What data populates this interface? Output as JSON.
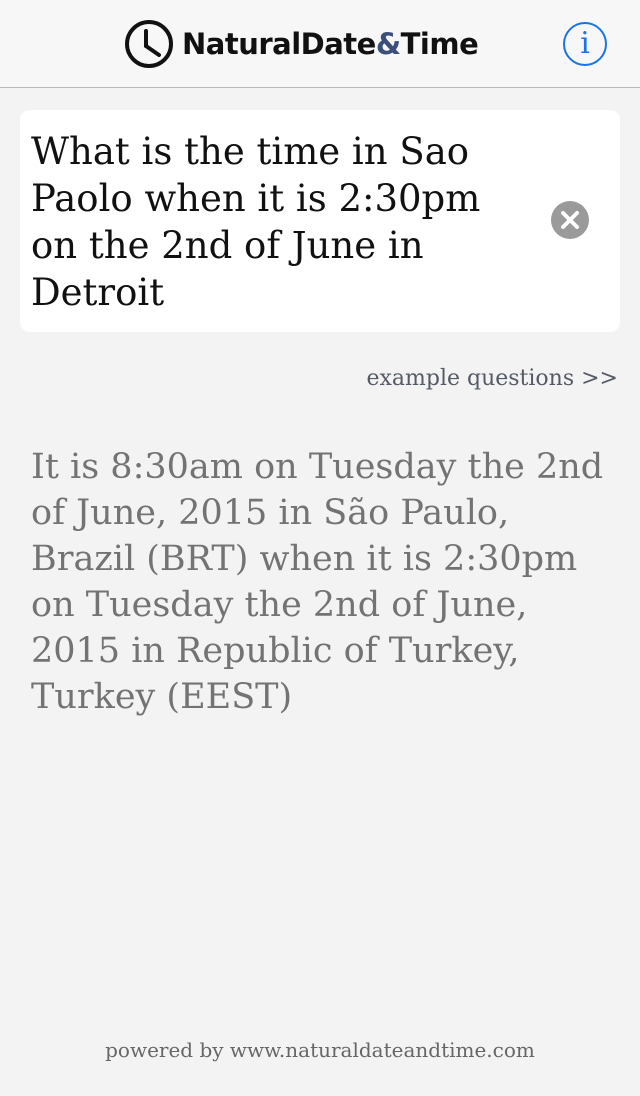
{
  "header": {
    "logo": {
      "part1": "NaturalDate",
      "amp": "&",
      "part2": "Time",
      "icon": "clock-icon"
    },
    "info_button": {
      "label": "i",
      "icon": "info-icon",
      "color": "#1a73e8"
    }
  },
  "question": {
    "value": "What is the time in Sao Paolo when it is 2:30pm on the 2nd of June in Detroit",
    "clear_icon": "clear-icon"
  },
  "example_link": "example questions >>",
  "answer": "It is 8:30am on Tuesday the 2nd of June, 2015 in São Paulo, Brazil (BRT) when it is 2:30pm on Tuesday the 2nd of June, 2015 in Republic of Turkey, Turkey (EEST)",
  "footer": "powered by www.naturaldateandtime.com"
}
